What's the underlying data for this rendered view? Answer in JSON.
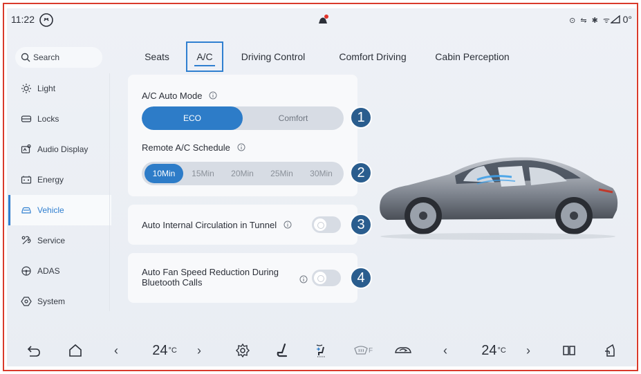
{
  "status_bar": {
    "time": "11:22",
    "status_icons": "⊙ ⇋ ✱ ᯤ",
    "temperature": "0°",
    "assistant_icon": "voice-assistant-icon",
    "notification_icon": "notification-bell-icon"
  },
  "search": {
    "placeholder": "Search"
  },
  "sidebar": {
    "items": [
      {
        "label": "Light",
        "icon": "light-icon"
      },
      {
        "label": "Locks",
        "icon": "locks-icon"
      },
      {
        "label": "Audio Display",
        "icon": "audio-display-icon"
      },
      {
        "label": "Energy",
        "icon": "energy-icon"
      },
      {
        "label": "Vehicle",
        "icon": "vehicle-icon",
        "active": true
      },
      {
        "label": "Service",
        "icon": "service-icon"
      },
      {
        "label": "ADAS",
        "icon": "adas-icon"
      },
      {
        "label": "System",
        "icon": "system-icon"
      }
    ]
  },
  "tabs": [
    {
      "label": "Seats"
    },
    {
      "label": "A/C",
      "active": true
    },
    {
      "label": "Driving Control"
    },
    {
      "label": "Comfort Driving"
    },
    {
      "label": "Cabin Perception"
    }
  ],
  "ac_auto_mode": {
    "label": "A/C Auto Mode",
    "options": [
      "ECO",
      "Comfort"
    ],
    "selected": "ECO",
    "badge": "1"
  },
  "remote_schedule": {
    "label": "Remote A/C Schedule",
    "options": [
      "10Min",
      "15Min",
      "20Min",
      "25Min",
      "30Min"
    ],
    "selected": "10Min",
    "badge": "2"
  },
  "tunnel_circulation": {
    "label": "Auto Internal Circulation in Tunnel",
    "enabled": false,
    "badge": "3"
  },
  "fan_reduction": {
    "label": "Auto Fan Speed Reduction During Bluetooth Calls",
    "enabled": false,
    "badge": "4"
  },
  "dock": {
    "left_temp": "24",
    "right_temp": "24",
    "temp_unit": "°C",
    "prev": "‹",
    "next": "›",
    "defrost_label": "F"
  },
  "colors": {
    "accent": "#2d7cc8",
    "badge": "#2a5d8e",
    "annotation_border": "#d93a2b"
  }
}
